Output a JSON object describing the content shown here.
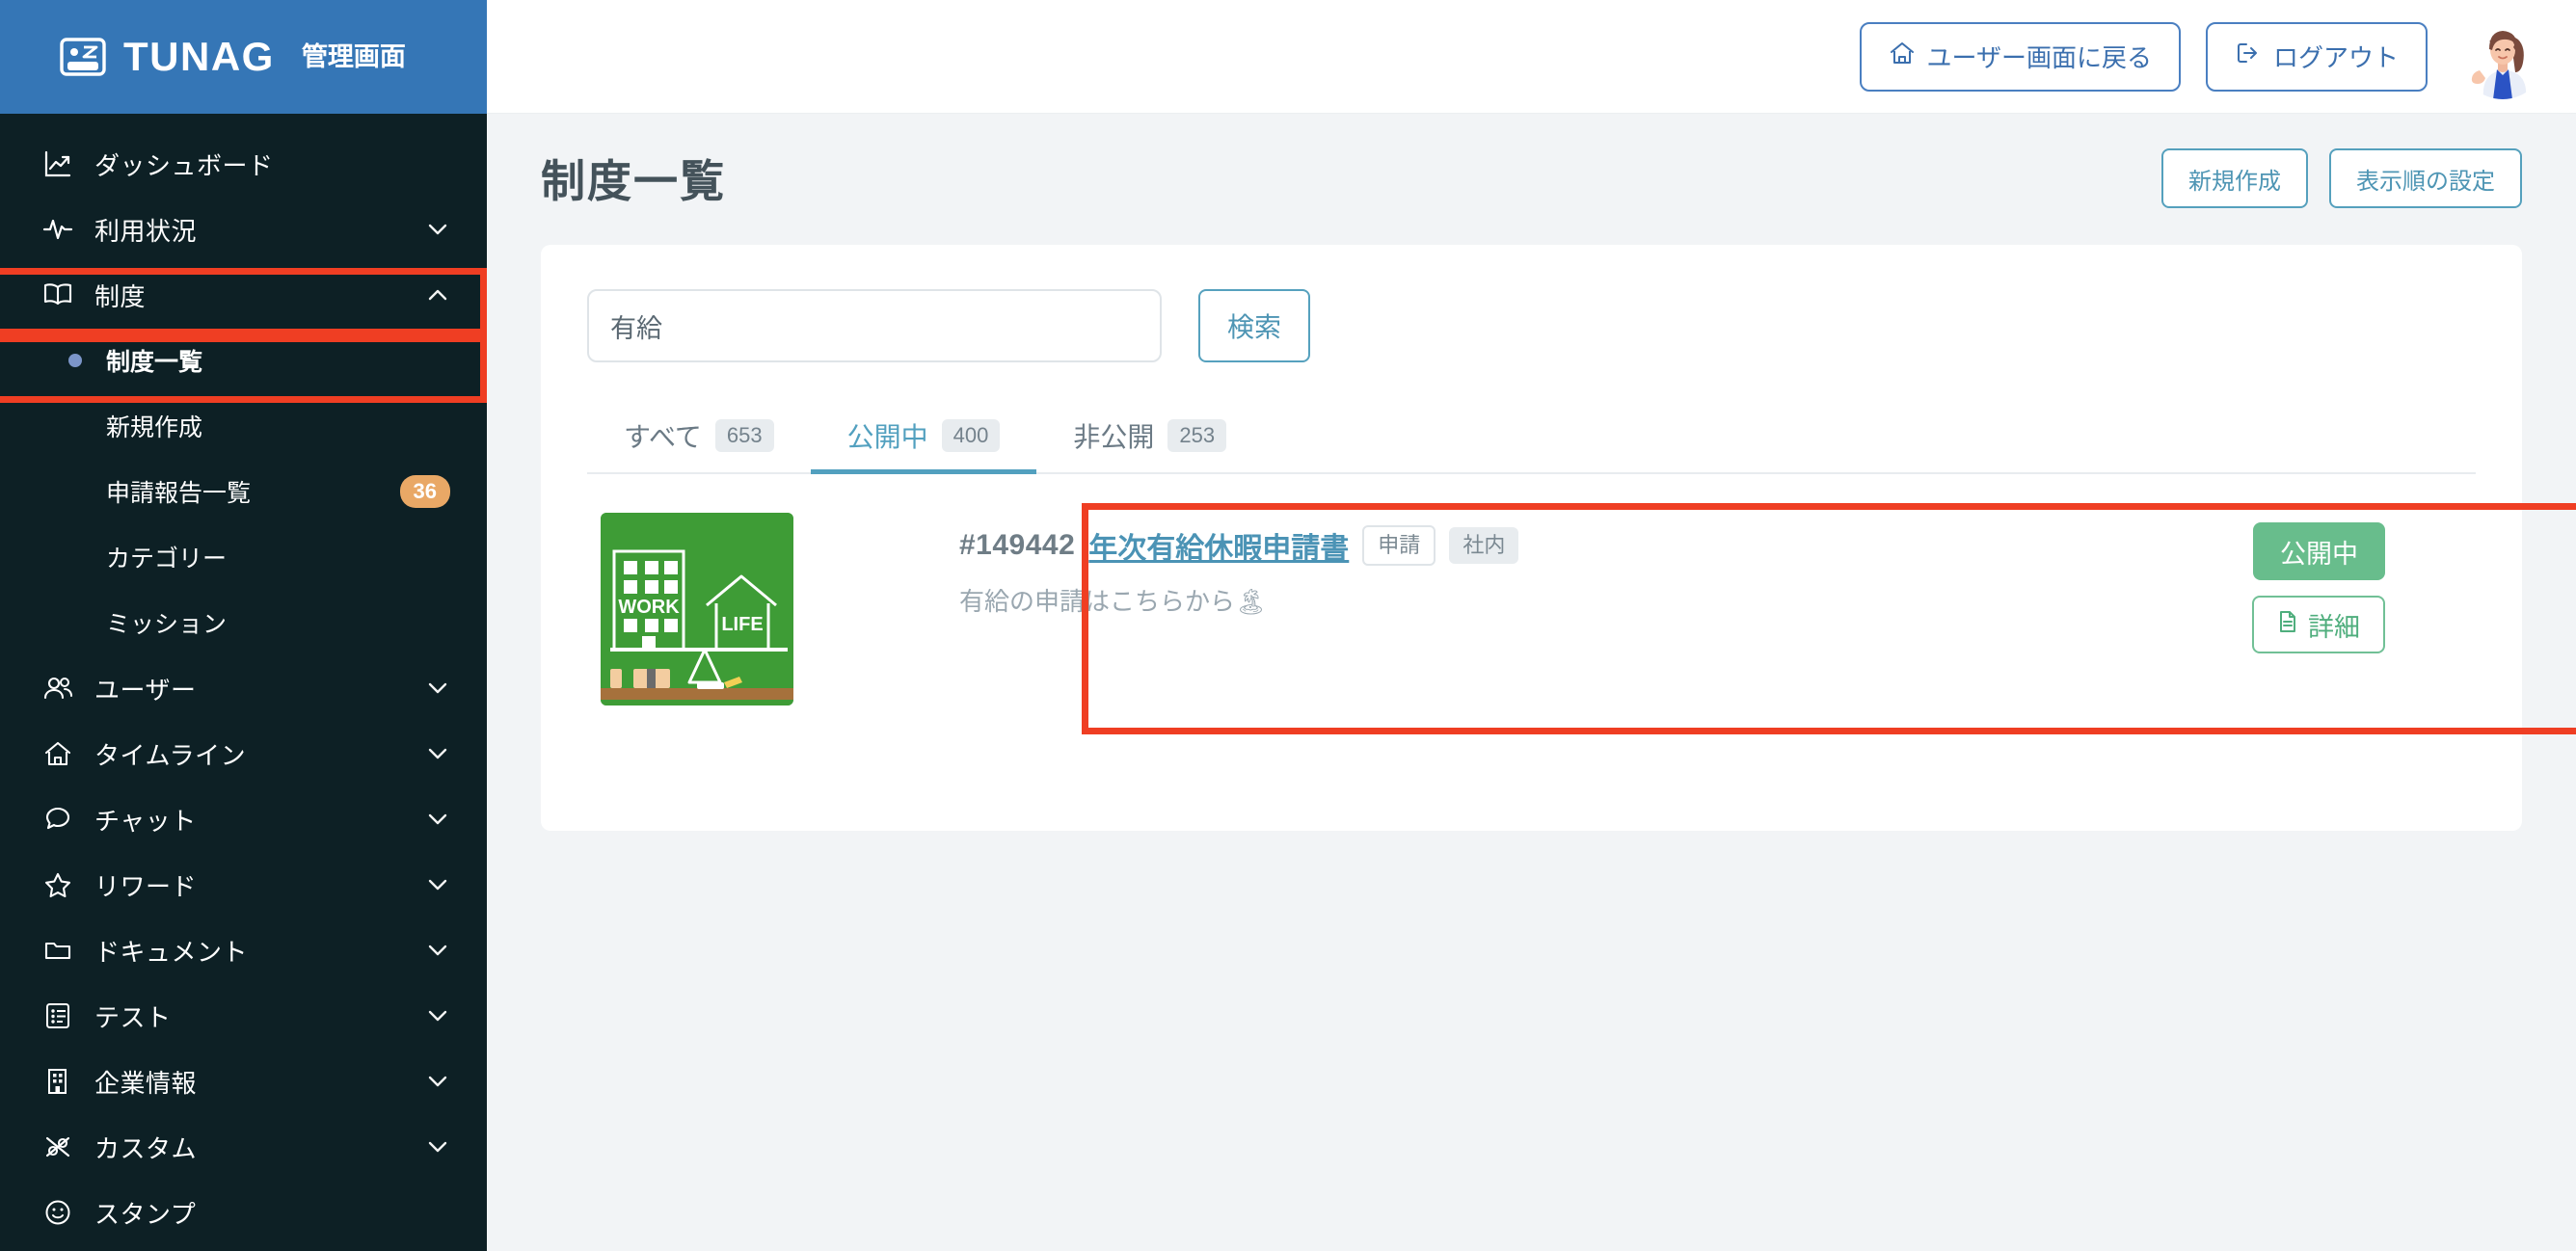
{
  "brand": {
    "logo_icon": "tunag-card-icon",
    "name": "TUNAG",
    "subtitle": "管理画面",
    "header_bg": "#3576b6"
  },
  "sidebar": {
    "bg": "#0d2025",
    "items": [
      {
        "label": "ダッシュボード",
        "icon": "chart-line-icon",
        "chevron": ""
      },
      {
        "label": "利用状況",
        "icon": "activity-pulse-icon",
        "chevron": "down"
      },
      {
        "label": "制度",
        "icon": "book-open-icon",
        "chevron": "up"
      }
    ],
    "sub_items": [
      {
        "label": "制度一覧",
        "bullet": true,
        "active": true,
        "badge": ""
      },
      {
        "label": "新規作成",
        "bullet": false,
        "active": false,
        "badge": ""
      },
      {
        "label": "申請報告一覧",
        "bullet": false,
        "active": false,
        "badge": "36"
      },
      {
        "label": "カテゴリー",
        "bullet": false,
        "active": false,
        "badge": ""
      },
      {
        "label": "ミッション",
        "bullet": false,
        "active": false,
        "badge": ""
      }
    ],
    "items_after": [
      {
        "label": "ユーザー",
        "icon": "users-icon",
        "chevron": "down"
      },
      {
        "label": "タイムライン",
        "icon": "home-icon",
        "chevron": "down"
      },
      {
        "label": "チャット",
        "icon": "chat-bubble-icon",
        "chevron": "down"
      },
      {
        "label": "リワード",
        "icon": "star-icon",
        "chevron": "down"
      },
      {
        "label": "ドキュメント",
        "icon": "folder-icon",
        "chevron": "down"
      },
      {
        "label": "テスト",
        "icon": "checklist-icon",
        "chevron": "down"
      },
      {
        "label": "企業情報",
        "icon": "building-icon",
        "chevron": "down"
      },
      {
        "label": "カスタム",
        "icon": "shuffle-icon",
        "chevron": "down"
      },
      {
        "label": "スタンプ",
        "icon": "smiley-icon",
        "chevron": ""
      }
    ],
    "badge_color": "#e9a866"
  },
  "topbar": {
    "back_to_user_label": "ユーザー画面に戻る",
    "back_to_user_icon": "home-icon",
    "logout_label": "ログアウト",
    "logout_icon": "logout-icon",
    "avatar_icon": "user-avatar-illustration"
  },
  "page": {
    "title": "制度一覧",
    "new_button": "新規作成",
    "order_button": "表示順の設定"
  },
  "search": {
    "value": "有給",
    "placeholder": "",
    "button_label": "検索"
  },
  "tabs": [
    {
      "label": "すべて",
      "count": "653",
      "active": false
    },
    {
      "label": "公開中",
      "count": "400",
      "active": true
    },
    {
      "label": "非公開",
      "count": "253",
      "active": false
    }
  ],
  "list": {
    "rows": [
      {
        "thumbnail_icon": "work-life-balance-chalkboard-image",
        "thumbnail_text_left": "WORK",
        "thumbnail_text_right": "LIFE",
        "id": "#149442",
        "title": "年次有給休暇申請書",
        "chips": [
          {
            "text": "申請",
            "style": "outline"
          },
          {
            "text": "社内",
            "style": "filled"
          }
        ],
        "description": "有給の申請はこちらから🏝",
        "status_button": "公開中",
        "detail_button": "詳細",
        "detail_icon": "document-icon"
      }
    ]
  },
  "annotations": {
    "color": "#ef3e23",
    "boxes": [
      "sidebar-item-seido",
      "sidebar-subitem-seido-list",
      "list-row-highlight"
    ]
  }
}
